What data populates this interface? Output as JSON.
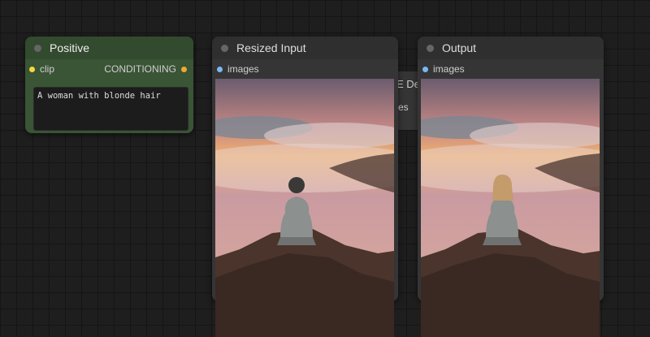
{
  "positive_node": {
    "title": "Positive",
    "input_label": "clip",
    "output_label": "CONDITIONING",
    "prompt_text": "A woman with blonde hair",
    "colors": {
      "body": "#3a5436",
      "header": "#324a2e",
      "clip_dot": "#f5d742",
      "conditioning_dot": "#f0a830"
    }
  },
  "hidden_node": {
    "title_fragment": "E De",
    "slot_fragment": "es"
  },
  "resized_node": {
    "title": "Resized Input",
    "input_label": "images",
    "image_subject": "man-in-beanie"
  },
  "output_node": {
    "title": "Output",
    "input_label": "images",
    "image_subject": "woman-with-blonde-hair"
  },
  "images_dot_color": "#7ab8f5"
}
